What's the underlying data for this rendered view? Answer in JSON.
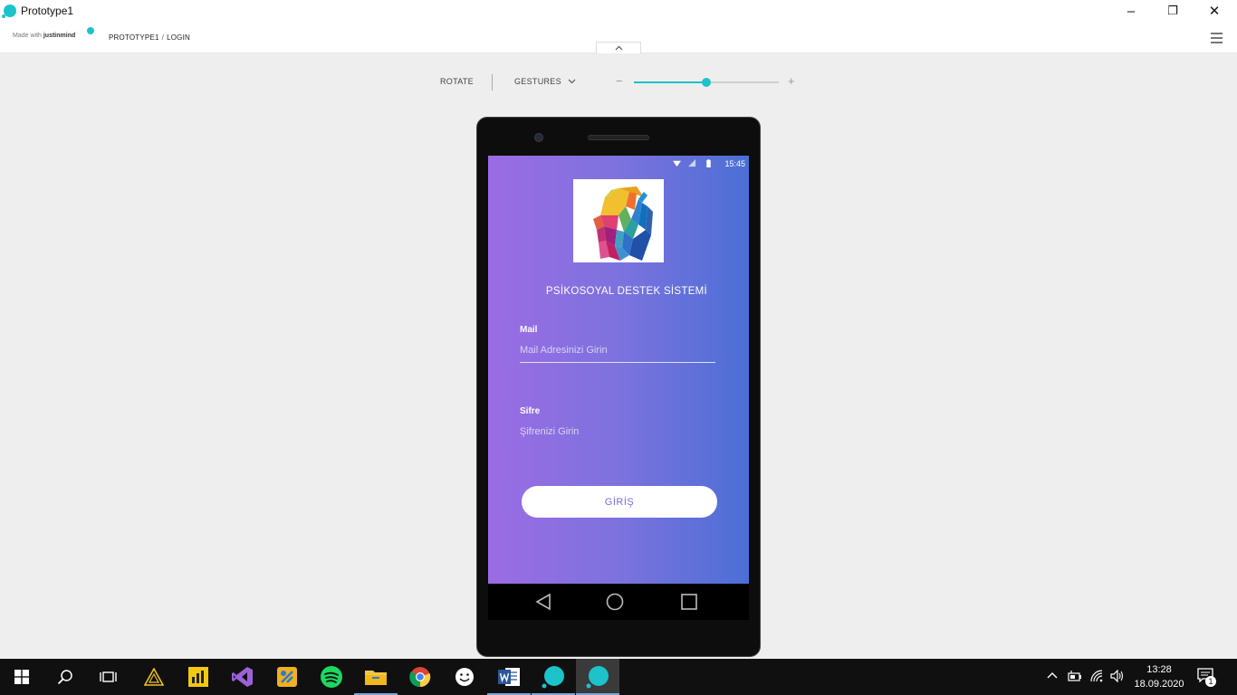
{
  "window": {
    "title": "Prototype1",
    "controls": {
      "minimize": "–",
      "restore": "❐",
      "close": "✕"
    }
  },
  "topbar": {
    "made_with_prefix": "Made with",
    "made_with_brand": "justinmind",
    "breadcrumb_project": "PROTOTYPE1",
    "breadcrumb_separator": "/",
    "breadcrumb_page": "LOGIN",
    "collapse_icon": "chevron-up-icon",
    "menu_icon": "hamburger-menu-icon"
  },
  "toolbar": {
    "rotate_label": "ROTATE",
    "gestures_label": "GESTURES",
    "zoom_minus": "−",
    "zoom_plus": "+",
    "zoom_level": 0.5,
    "accent_color": "#1cc3c9"
  },
  "phone": {
    "status_time": "15:45",
    "app_title": "PSİKOSOYAL DESTEK SİSTEMİ",
    "mail_label": "Mail",
    "mail_placeholder": "Mail Adresinizi Girin",
    "password_label": "Sifre",
    "password_placeholder": "Şifrenizi Girin",
    "login_button": "GİRİŞ",
    "nav": [
      "back-icon",
      "home-icon",
      "recents-icon"
    ]
  },
  "taskbar": {
    "items": [
      {
        "name": "start-button",
        "icon": "windows-logo-icon"
      },
      {
        "name": "search-button",
        "icon": "search-icon"
      },
      {
        "name": "task-view-button",
        "icon": "task-view-icon"
      },
      {
        "name": "taskbar-app-1",
        "icon": "triangle-app-icon"
      },
      {
        "name": "taskbar-power-bi",
        "icon": "power-bi-icon"
      },
      {
        "name": "taskbar-visual-studio",
        "icon": "visual-studio-icon"
      },
      {
        "name": "taskbar-app-5",
        "icon": "app-icon"
      },
      {
        "name": "taskbar-spotify",
        "icon": "spotify-icon"
      },
      {
        "name": "taskbar-file-explorer",
        "icon": "folder-icon"
      },
      {
        "name": "taskbar-chrome",
        "icon": "chrome-icon"
      },
      {
        "name": "taskbar-smiley-app",
        "icon": "smiley-icon"
      },
      {
        "name": "taskbar-word",
        "icon": "word-icon"
      },
      {
        "name": "taskbar-justinmind-1",
        "icon": "justinmind-icon"
      },
      {
        "name": "taskbar-justinmind-2",
        "icon": "justinmind-icon"
      }
    ],
    "time": "13:28",
    "date": "18.09.2020",
    "notification_count": "1"
  }
}
